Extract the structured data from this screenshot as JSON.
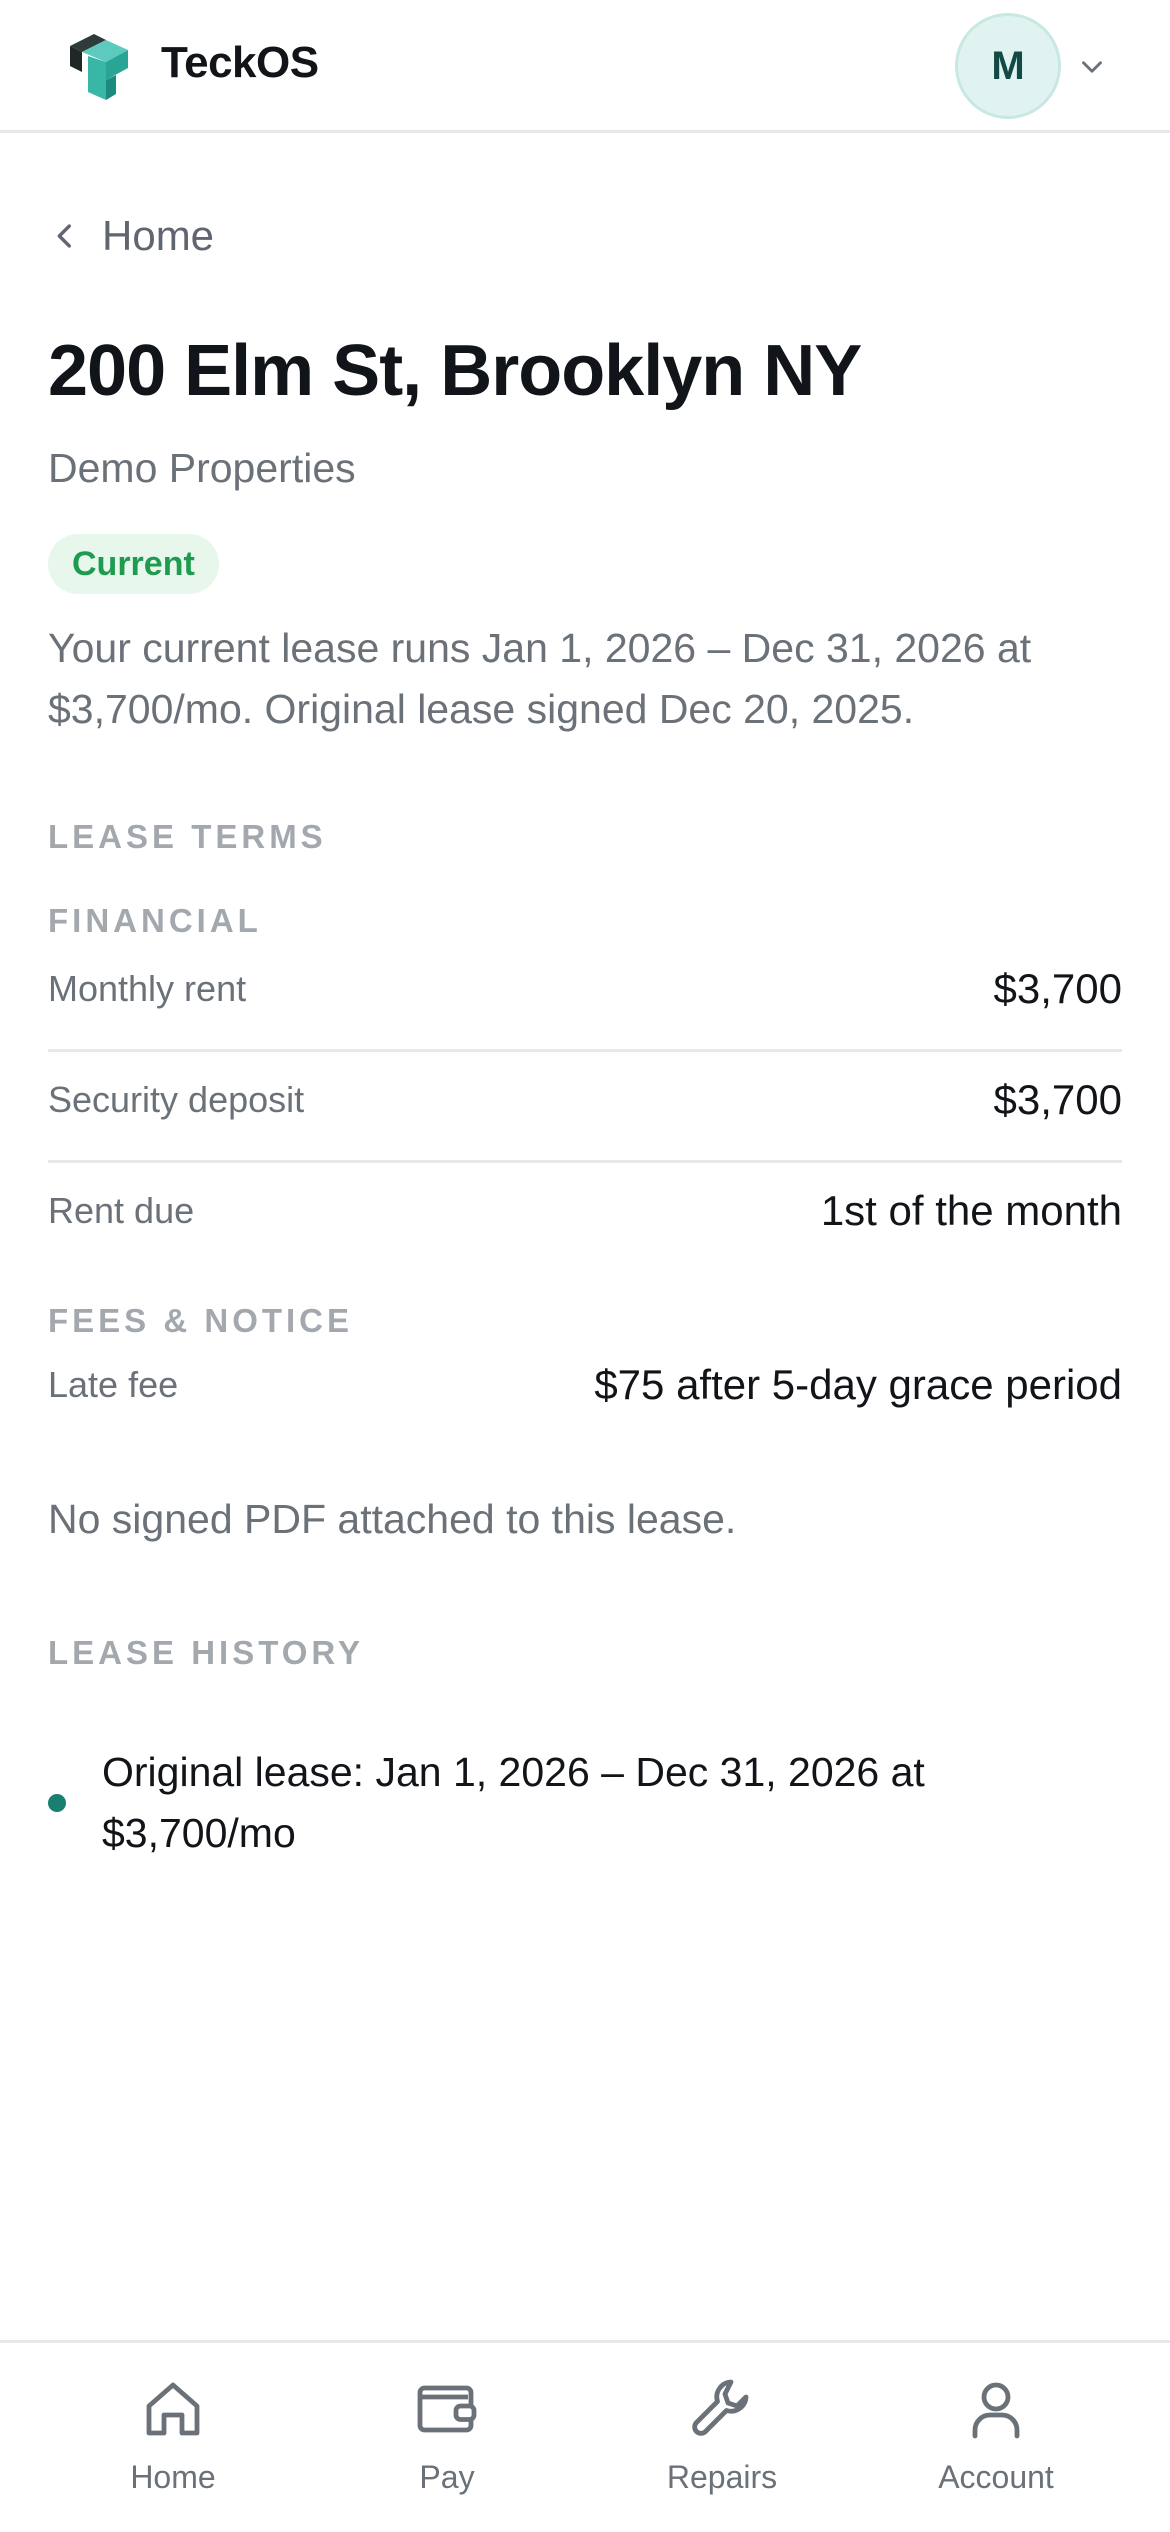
{
  "app": {
    "brand": "TeckOS"
  },
  "header": {
    "avatar_initial": "M",
    "logo_icon": "teckos-logo-icon",
    "menu_icon": "chevron-down-icon"
  },
  "colors": {
    "accent": "#1a7f73",
    "status_green": "#1f9b4f",
    "badge_bg": "#e8f7ec",
    "muted": "#6b7178"
  },
  "breadcrumb": {
    "back_label": "Home",
    "icon": "chevron-left-icon"
  },
  "property": {
    "address": "200 Elm St, Brooklyn NY",
    "company": "Demo Properties",
    "status": "Current",
    "summary": "Your current lease runs Jan 1, 2026 – Dec 31, 2026 at $3,700/mo. Original lease signed Dec 20, 2025."
  },
  "lease_terms": {
    "heading": "LEASE TERMS",
    "financial": {
      "heading": "FINANCIAL",
      "rows": [
        {
          "label": "Monthly rent",
          "value": "$3,700"
        },
        {
          "label": "Security deposit",
          "value": "$3,700"
        },
        {
          "label": "Rent due",
          "value": "1st of the month"
        }
      ]
    },
    "fees": {
      "heading": "FEES & NOTICE",
      "rows": [
        {
          "label": "Late fee",
          "value": "$75 after 5-day grace period"
        }
      ]
    }
  },
  "pdf_note": "No signed PDF attached to this lease.",
  "lease_history": {
    "heading": "LEASE HISTORY",
    "items": [
      {
        "text": "Original lease: Jan 1, 2026 – Dec 31, 2026 at $3,700/mo"
      }
    ]
  },
  "bottom_nav": [
    {
      "label": "Home",
      "icon": "home-icon"
    },
    {
      "label": "Pay",
      "icon": "wallet-icon"
    },
    {
      "label": "Repairs",
      "icon": "wrench-icon"
    },
    {
      "label": "Account",
      "icon": "user-icon"
    }
  ]
}
